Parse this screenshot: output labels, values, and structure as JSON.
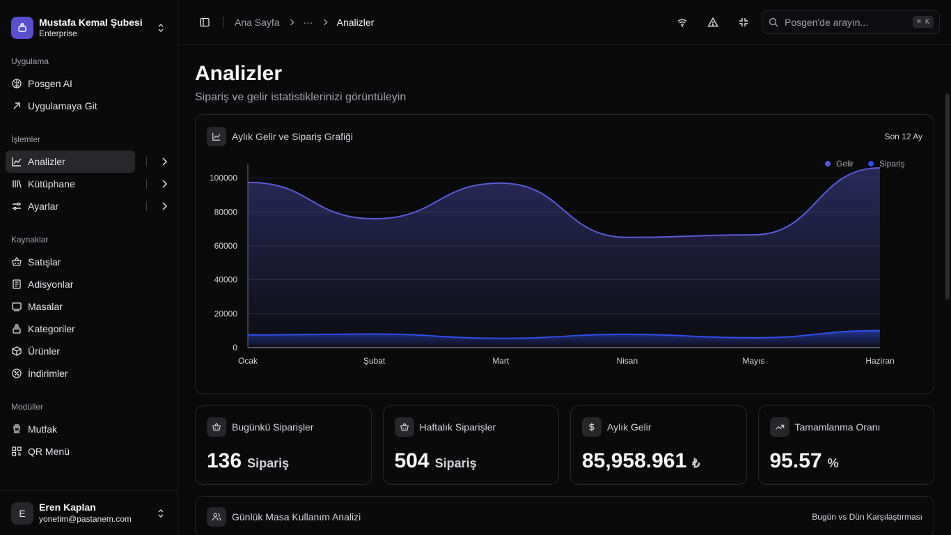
{
  "org": {
    "name": "Mustafa Kemal Şubesi",
    "plan": "Enterprise"
  },
  "sidebar": {
    "groups": [
      {
        "label": "Uygulama",
        "items": [
          {
            "label": "Posgen AI",
            "icon": "brain-icon"
          },
          {
            "label": "Uygulamaya Git",
            "icon": "arrow-up-right-icon"
          }
        ]
      },
      {
        "label": "İşlemler",
        "items": [
          {
            "label": "Analizler",
            "icon": "chart-line-icon",
            "active": true
          },
          {
            "label": "Kütüphane",
            "icon": "library-icon"
          },
          {
            "label": "Ayarlar",
            "icon": "sliders-icon"
          }
        ]
      },
      {
        "label": "Kaynaklar",
        "items": [
          {
            "label": "Satışlar",
            "icon": "basket-icon"
          },
          {
            "label": "Adisyonlar",
            "icon": "receipt-icon"
          },
          {
            "label": "Masalar",
            "icon": "table-icon"
          },
          {
            "label": "Kategoriler",
            "icon": "layers-icon"
          },
          {
            "label": "Ürünler",
            "icon": "box-icon"
          },
          {
            "label": "İndirimler",
            "icon": "discount-icon"
          }
        ]
      },
      {
        "label": "Modüller",
        "items": [
          {
            "label": "Mutfak",
            "icon": "chef-hat-icon"
          },
          {
            "label": "QR Menü",
            "icon": "qr-code-icon"
          }
        ]
      }
    ]
  },
  "user": {
    "initial": "E",
    "name": "Eren Kaplan",
    "email": "yonetim@pastanem.com"
  },
  "topbar": {
    "crumbs": {
      "home": "Ana Sayfa",
      "ellipsis": "···",
      "current": "Analizler"
    },
    "search": {
      "placeholder": "Posgen'de arayın...",
      "shortcut": "⌘ K"
    }
  },
  "page": {
    "title": "Analizler",
    "subtitle": "Sipariş ve gelir istatistiklerinizi görüntüleyin"
  },
  "chart_card": {
    "title": "Aylık Gelir ve Sipariş Grafiği",
    "range": "Son 12 Ay"
  },
  "chart_data": {
    "type": "area",
    "categories": [
      "Ocak",
      "Şubat",
      "Mart",
      "Nisan",
      "Mayıs",
      "Haziran"
    ],
    "series": [
      {
        "name": "Gelir",
        "color": "#5b5bd6",
        "values": [
          97500,
          76000,
          97000,
          65000,
          66500,
          106000
        ]
      },
      {
        "name": "Sipariş",
        "color": "#2e4fe8",
        "values": [
          7500,
          8000,
          5500,
          7800,
          5800,
          10000
        ]
      }
    ],
    "yticks": [
      0,
      20000,
      40000,
      60000,
      80000,
      100000
    ],
    "ylim": [
      0,
      106000
    ],
    "grid": true,
    "legend": "top-right"
  },
  "stats": [
    {
      "title": "Bugünkü Siparişler",
      "value": "136",
      "unit": "Sipariş",
      "icon": "basket-icon"
    },
    {
      "title": "Haftalık Siparişler",
      "value": "504",
      "unit": "Sipariş",
      "icon": "basket-icon"
    },
    {
      "title": "Aylık Gelir",
      "value": "85,958.961",
      "unit": "₺",
      "icon": "dollar-icon"
    },
    {
      "title": "Tamamlanma Oranı",
      "value": "95.57",
      "unit": "%",
      "icon": "trending-up-icon"
    }
  ],
  "table_card": {
    "title": "Günlük Masa Kullanım Analizi",
    "subtitle": "Bugün vs Dün Karşılaştırması"
  }
}
